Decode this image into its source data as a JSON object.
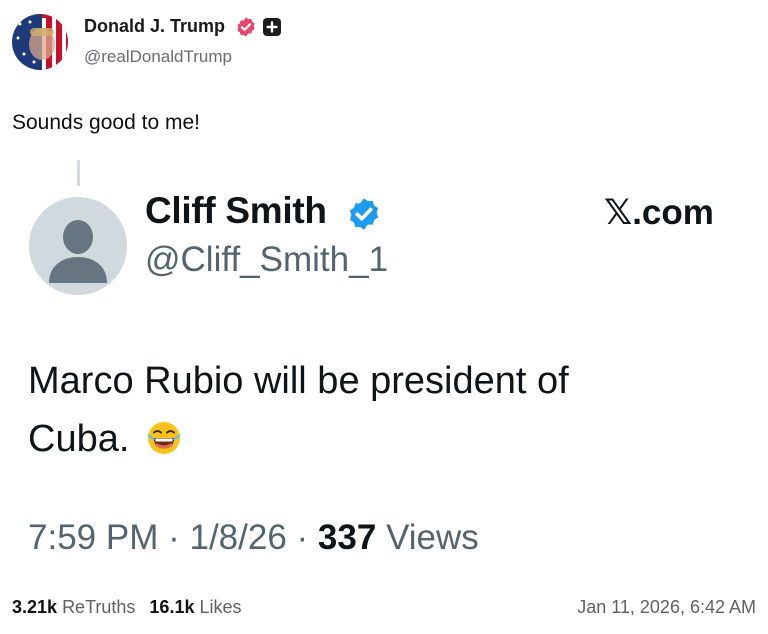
{
  "post": {
    "author_name": "Donald J. Trump",
    "author_handle": "@realDonaldTrump",
    "text": "Sounds good to me!",
    "retruths_count": "3.21k",
    "retruths_label": "ReTruths",
    "likes_count": "16.1k",
    "likes_label": "Likes",
    "timestamp": "Jan 11, 2026, 6:42 AM",
    "icons": {
      "verified": "verified-badge-icon",
      "plus": "plus-badge-icon"
    },
    "colors": {
      "verified_badge": "#e8466c"
    }
  },
  "embedded_tweet": {
    "author_name": "Cliff Smith",
    "author_handle": "@Cliff_Smith_1",
    "brand": "𝕏.com",
    "text": "Marco Rubio will be president of Cuba.",
    "emoji": "😂",
    "time": "7:59 PM",
    "separator": "·",
    "date": "1/8/26",
    "views_count": "337",
    "views_label": "Views",
    "icons": {
      "verified": "verified-badge-icon",
      "avatar": "default-avatar-icon"
    },
    "colors": {
      "verified_badge": "#1d9bf0"
    }
  }
}
